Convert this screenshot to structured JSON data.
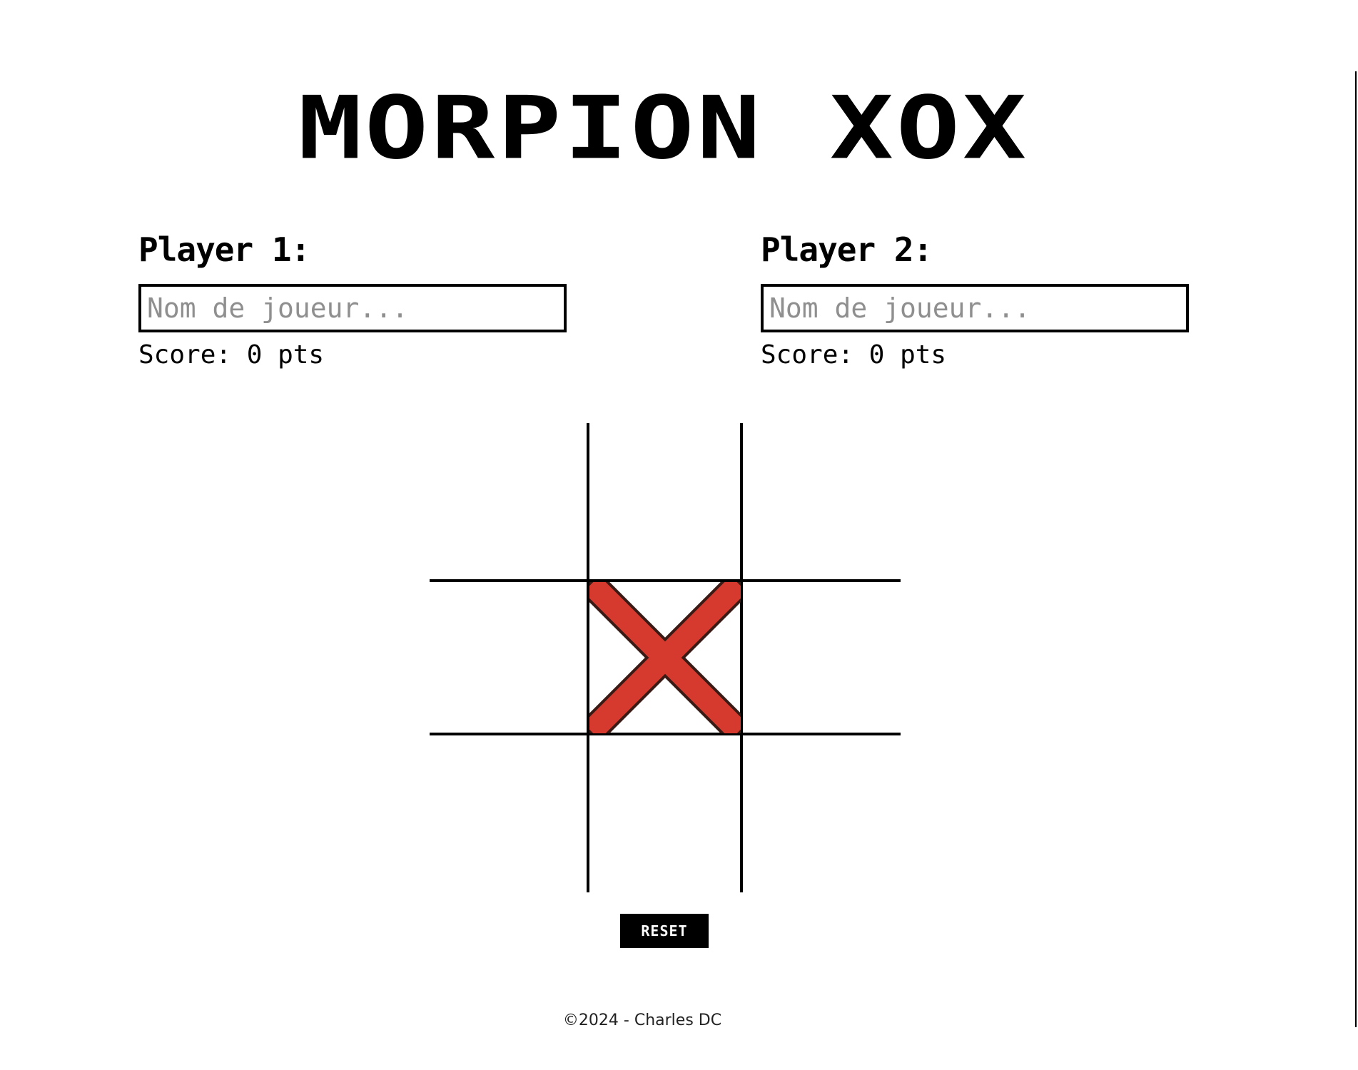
{
  "title": "MORPION XOX",
  "players": [
    {
      "label": "Player 1:",
      "placeholder": "Nom de joueur...",
      "value": "",
      "score": "Score: 0 pts"
    },
    {
      "label": "Player 2:",
      "placeholder": "Nom de joueur...",
      "value": "",
      "score": "Score: 0 pts"
    }
  ],
  "board": {
    "cells": [
      "",
      "",
      "",
      "",
      "X",
      "",
      "",
      "",
      ""
    ],
    "mark_colors": {
      "X": "#d63a2e"
    }
  },
  "reset_label": "RESET",
  "footer": "©2024 - Charles DC"
}
